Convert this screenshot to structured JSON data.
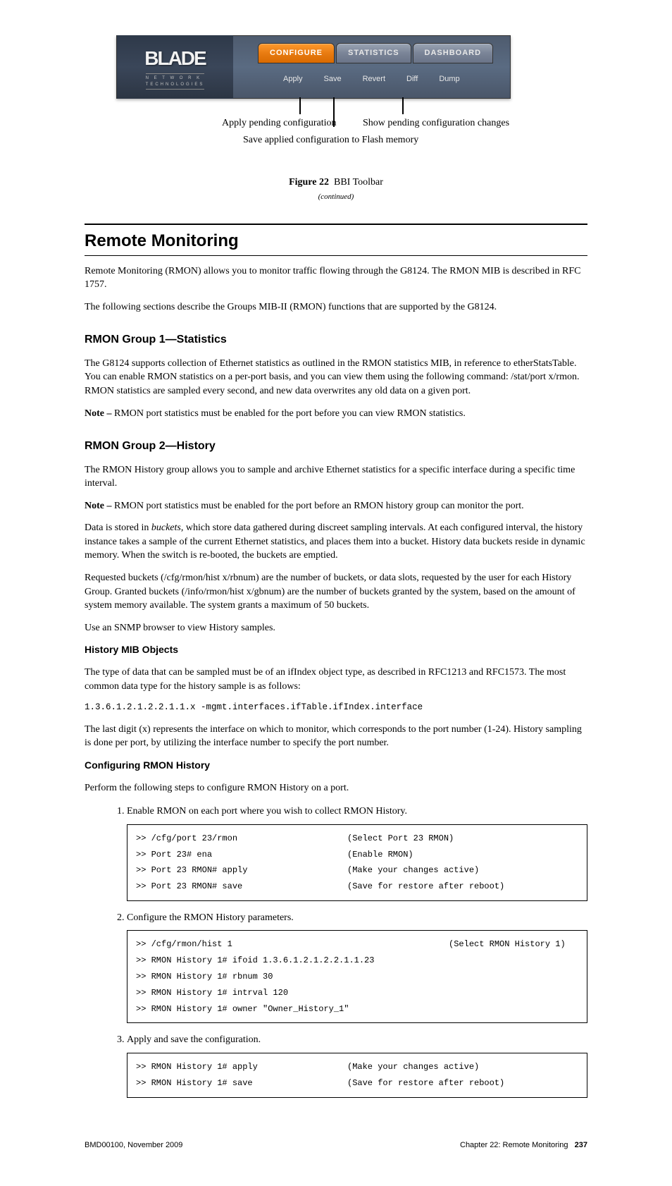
{
  "toolbar": {
    "logo_main": "BLADE",
    "logo_sub_line1": "N E T W O R K",
    "logo_sub_line2": "TECHNOLOGIES",
    "tabs": [
      "CONFIGURE",
      "STATISTICS",
      "DASHBOARD"
    ],
    "subbuttons": [
      "Apply",
      "Save",
      "Revert",
      "Diff",
      "Dump"
    ]
  },
  "callouts": {
    "apply": "Apply pending configuration",
    "save": "Save applied configuration to Flash memory",
    "diff": "Show pending configuration changes"
  },
  "figure": {
    "number": "Figure 22",
    "caption": "BBI Toolbar",
    "continued": "(continued)"
  },
  "section": {
    "heading": "Remote Monitoring",
    "p1": "Remote Monitoring (RMON) allows you to monitor traffic flowing through the G8124. The RMON MIB is described in RFC 1757.",
    "p2": "The following sections describe the Groups MIB-II (RMON) functions that are supported by the G8124."
  },
  "subsection": {
    "heading": "RMON Group 1—Statistics",
    "p1": "The G8124 supports collection of Ethernet statistics as outlined in the RMON statistics MIB, in reference to etherStatsTable. You can enable RMON statistics on a per-port basis, and you can view them using the following command: /stat/port x/rmon. RMON statistics are sampled every second, and new data overwrites any old data on a given port.",
    "note_label": "Note – ",
    "note_text": "RMON port statistics must be enabled for the port before you can view RMON statistics."
  },
  "history": {
    "heading": "RMON Group 2—History",
    "p1": "The RMON History group allows you to sample and archive Ethernet statistics for a specific interface during a specific time interval.",
    "note_label": "Note – ",
    "note_text": "RMON port statistics must be enabled for the port before an RMON history group can monitor the port.",
    "p2_pre": "Data is stored in ",
    "p2_term": "buckets",
    "p2_post": ", which store data gathered during discreet sampling intervals. At each configured interval, the history instance takes a sample of the current Ethernet statistics, and places them into a bucket. History data buckets reside in dynamic memory. When the switch is re-booted, the buckets are emptied.",
    "p3_pre": "Requested buckets (/cfg/rmon/hist x/rbnum) are the number of buckets, or data slots, requested by the user for each History Group. Granted buckets (/info/rmon/hist x/gbnum) are the number of buckets granted by the system, based on the amount of system memory available. The system grants a maximum of 50 buckets.",
    "p4": "Use an SNMP browser to view History samples.",
    "mib_heading": "History MIB Objects",
    "mib_p_pre": "The type of data that can be sampled must be of an ifIndex object type, as described in RFC1213 and RFC1573. The most common data type for the history sample is as follows:",
    "mib_oid": "1.3.6.1.2.1.2.2.1.1.x -mgmt.interfaces.ifTable.ifIndex.interface",
    "mib_p_post_pre": "The last digit (",
    "mib_p_post_x": "x",
    "mib_p_post_mid": ") represents the interface on which to monitor, which corresponds to the port number (1-24). History sampling is done per port, by utilizing the interface number to specify the port number.",
    "config_heading": "Configuring RMON History",
    "config_p": "Perform the following steps to configure RMON History on a port."
  },
  "steps": [
    "Enable RMON on each port where you wish to collect RMON History.",
    "Configure the RMON History parameters.",
    "Apply and save the configuration."
  ],
  "terminal1": [
    {
      "cmd": ">> /cfg/port 23/rmon",
      "comment": "(Select Port 23 RMON)"
    },
    {
      "cmd": ">> Port 23# ena",
      "comment": "(Enable RMON)"
    },
    {
      "cmd": ">> Port 23 RMON# apply",
      "comment": "(Make your changes active)"
    },
    {
      "cmd": ">> Port 23 RMON# save",
      "comment": "(Save for restore after reboot)"
    }
  ],
  "terminal2": [
    {
      "cmd": ">> /cfg/rmon/hist 1",
      "comment": "                    (Select RMON History 1)"
    },
    {
      "cmd": ">> RMON History 1# ifoid 1.3.6.1.2.1.2.2.1.1.23",
      "comment": ""
    },
    {
      "cmd": ">> RMON History 1# rbnum 30",
      "comment": ""
    },
    {
      "cmd": ">> RMON History 1# intrval 120",
      "comment": ""
    },
    {
      "cmd": ">> RMON History 1# owner \"Owner_History_1\"",
      "comment": ""
    }
  ],
  "terminal3": [
    {
      "cmd": ">> RMON History 1# apply",
      "comment": "(Make your changes active)"
    },
    {
      "cmd": ">> RMON History 1# save",
      "comment": "(Save for restore after reboot)"
    }
  ],
  "footer": {
    "left": "BMD00100, November 2009",
    "chapter": "Chapter 22: Remote Monitoring",
    "page": "237"
  }
}
